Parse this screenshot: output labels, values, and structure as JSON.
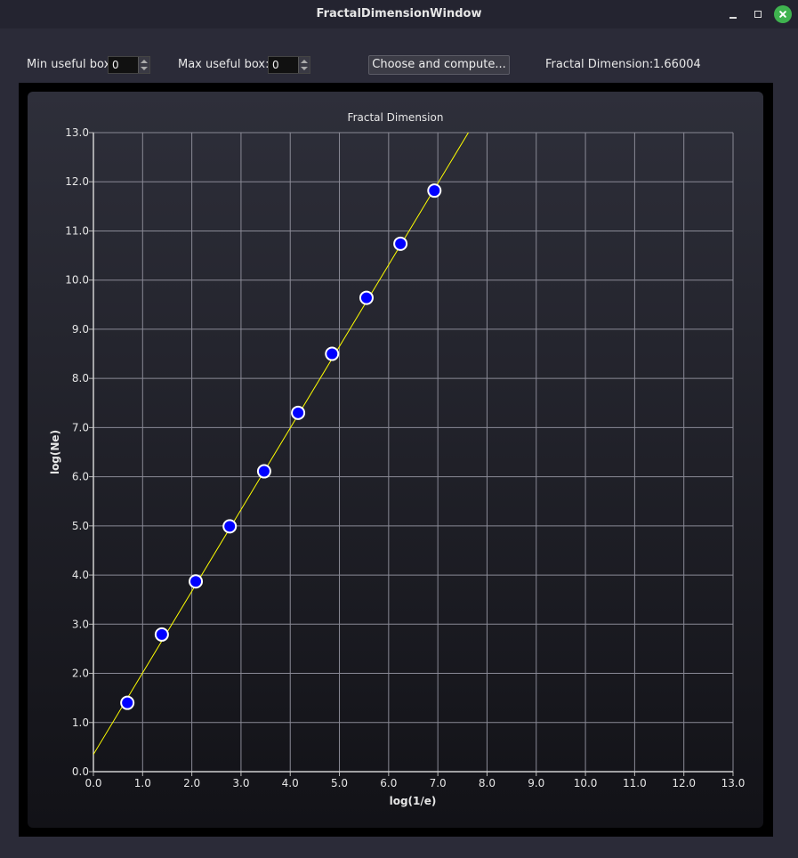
{
  "window": {
    "title": "FractalDimensionWindow"
  },
  "toolbar": {
    "min_label": "Min useful box:",
    "min_value": "0",
    "max_label": "Max useful box:",
    "max_value": "0",
    "compute_button": "Choose and compute...",
    "fd_label": "Fractal Dimension:",
    "fd_value": "1.66004"
  },
  "colors": {
    "point_fill": "#0000ff",
    "point_stroke": "#ffffff",
    "fit_line": "#ffff00",
    "grid": "#8a8a96"
  },
  "chart_data": {
    "type": "scatter",
    "title": "Fractal Dimension",
    "xlabel": "log(1/e)",
    "ylabel": "log(Ne)",
    "xlim": [
      0,
      13
    ],
    "ylim": [
      0,
      13
    ],
    "grid": true,
    "xticks": [
      "0.0",
      "1.0",
      "2.0",
      "3.0",
      "4.0",
      "5.0",
      "6.0",
      "7.0",
      "8.0",
      "9.0",
      "10.0",
      "11.0",
      "12.0",
      "13.0"
    ],
    "yticks": [
      "0.0",
      "1.0",
      "2.0",
      "3.0",
      "4.0",
      "5.0",
      "6.0",
      "7.0",
      "8.0",
      "9.0",
      "10.0",
      "11.0",
      "12.0",
      "13.0"
    ],
    "points": [
      {
        "x": 0.69,
        "y": 1.4
      },
      {
        "x": 1.39,
        "y": 2.79
      },
      {
        "x": 2.08,
        "y": 3.87
      },
      {
        "x": 2.77,
        "y": 4.99
      },
      {
        "x": 3.47,
        "y": 6.11
      },
      {
        "x": 4.16,
        "y": 7.3
      },
      {
        "x": 4.85,
        "y": 8.5
      },
      {
        "x": 5.55,
        "y": 9.64
      },
      {
        "x": 6.24,
        "y": 10.74
      },
      {
        "x": 6.93,
        "y": 11.82
      }
    ],
    "fit_line": {
      "slope": 1.66004,
      "intercept": 0.35
    }
  }
}
